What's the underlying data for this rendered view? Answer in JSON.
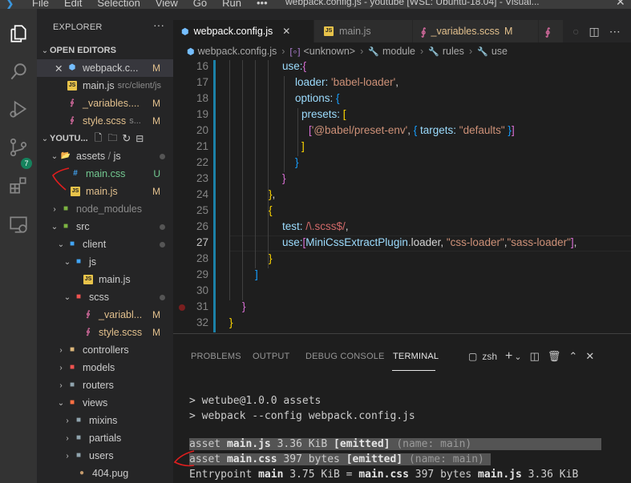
{
  "titlebar": {
    "menu": [
      "File",
      "Edit",
      "Selection",
      "View",
      "Go",
      "Run",
      "•••"
    ],
    "title": "webpack.config.js - youtube [WSL: Ubuntu-18.04] - Visual..."
  },
  "activity": {
    "scm_badge": "7"
  },
  "sidebar": {
    "title": "EXPLORER",
    "more": "···",
    "open_editors_label": "OPEN EDITORS",
    "open_editors": [
      {
        "name": "webpack.c...",
        "status": "M"
      },
      {
        "name": "main.js",
        "path": "src/client/js",
        "status": ""
      },
      {
        "name": "_variables....",
        "status": "M"
      },
      {
        "name": "style.scss",
        "path": "s...",
        "status": "M"
      }
    ],
    "workspace_label": "YOUTU...",
    "tree": [
      {
        "label": "assets",
        "suffix": "js"
      },
      {
        "label": "main.css",
        "status": "U"
      },
      {
        "label": "main.js",
        "status": "M"
      },
      {
        "label": "node_modules"
      },
      {
        "label": "src"
      },
      {
        "label": "client"
      },
      {
        "label": "js"
      },
      {
        "label": "main.js"
      },
      {
        "label": "scss"
      },
      {
        "label": "_variabl...",
        "status": "M"
      },
      {
        "label": "style.scss",
        "status": "M"
      },
      {
        "label": "controllers"
      },
      {
        "label": "models"
      },
      {
        "label": "routers"
      },
      {
        "label": "views"
      },
      {
        "label": "mixins"
      },
      {
        "label": "partials"
      },
      {
        "label": "users"
      },
      {
        "label": "404.pug"
      }
    ]
  },
  "tabs": [
    {
      "label": "webpack.config.js",
      "active": true
    },
    {
      "label": "main.js",
      "active": false
    },
    {
      "label": "_variables.scss",
      "status": "M",
      "active": false
    }
  ],
  "breadcrumb": [
    "webpack.config.js",
    "<unknown>",
    "module",
    "rules",
    "use"
  ],
  "editor": {
    "line_numbers": [
      "16",
      "17",
      "18",
      "19",
      "20",
      "21",
      "22",
      "23",
      "24",
      "25",
      "26",
      "27",
      "28",
      "29",
      "30",
      "31",
      "32"
    ],
    "current_line": "27",
    "lines": {
      "l16": "use:",
      "l17a": "loader: ",
      "l17b": "'babel-loader'",
      "l18": "options: ",
      "l19": "presets: ",
      "l20a": "'@babel/preset-env'",
      "l20b": "targets: ",
      "l20c": "\"defaults\"",
      "l26a": "test: ",
      "l26b": "/\\.scss$/",
      "l27a": "use:",
      "l27b": "MiniCssExtractPlugin",
      "l27c": ".loader, ",
      "l27d": "\"css-loader\"",
      "l27e": "\"sass-loader\""
    }
  },
  "panel": {
    "tabs": [
      "PROBLEMS",
      "OUTPUT",
      "DEBUG CONSOLE",
      "TERMINAL"
    ],
    "active_tab": "TERMINAL",
    "shell": "zsh",
    "terminal": {
      "cmd1": "> wetube@1.0.0 assets",
      "cmd2": "> webpack --config webpack.config.js",
      "asset1_prefix": "asset ",
      "asset1_file": "main.js",
      "asset1_size": " 3.36 KiB ",
      "asset1_flag": "[emitted]",
      "asset1_name": " (name: main)",
      "asset2_prefix": "asset ",
      "asset2_file": "main.css",
      "asset2_size": " 397 bytes ",
      "asset2_flag": "[emitted]",
      "asset2_name": " (name: main)",
      "entry_prefix": "Entrypoint ",
      "entry_name": "main",
      "entry_size": " 3.75 KiB = ",
      "entry_css": "main.css",
      "entry_css_size": " 397 bytes ",
      "entry_js": "main.js",
      "entry_js_size": " 3.36 KiB"
    }
  },
  "colors": {
    "accent": "#007acc",
    "annotation": "#e01e1e"
  }
}
